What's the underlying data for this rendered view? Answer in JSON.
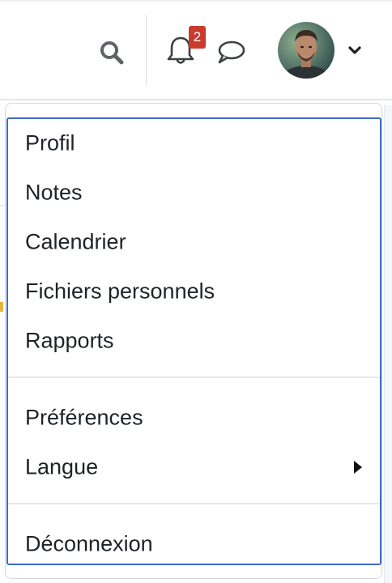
{
  "header": {
    "notifications": {
      "count": "2"
    },
    "icons": {
      "search": "search-icon",
      "notifications": "bell-icon",
      "messages": "chat-icon",
      "user_menu": "chevron-down-icon"
    }
  },
  "user_menu": {
    "items": [
      {
        "label": "Profil"
      },
      {
        "label": "Notes"
      },
      {
        "label": "Calendrier"
      },
      {
        "label": "Fichiers personnels"
      },
      {
        "label": "Rapports"
      },
      {
        "label": "Préférences"
      },
      {
        "label": "Langue",
        "has_submenu": true
      },
      {
        "label": "Déconnexion"
      }
    ]
  },
  "colors": {
    "badge": "#cc3a2e",
    "menu_focus_border": "#3e6cc8",
    "text": "#1f2226"
  }
}
